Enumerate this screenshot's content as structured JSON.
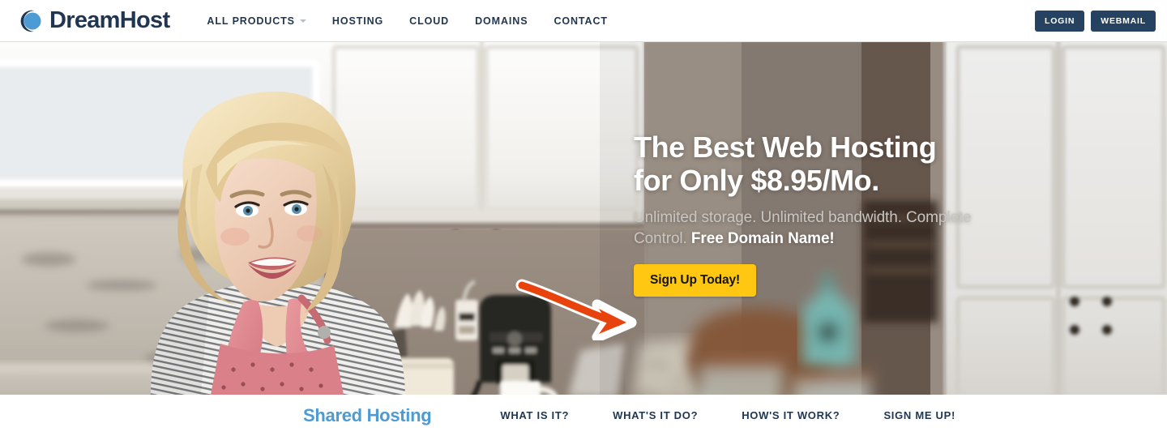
{
  "header": {
    "logo": {
      "text": "DreamHost",
      "icon": "dreamhost-crescent-logo",
      "mark_dark": "#1f3551",
      "mark_light": "#4C9BD4"
    },
    "nav": [
      {
        "label": "ALL PRODUCTS",
        "has_caret": true
      },
      {
        "label": "HOSTING",
        "has_caret": false
      },
      {
        "label": "CLOUD",
        "has_caret": false
      },
      {
        "label": "DOMAINS",
        "has_caret": false
      },
      {
        "label": "CONTACT",
        "has_caret": false
      }
    ],
    "actions": [
      {
        "label": "LOGIN"
      },
      {
        "label": "WEBMAIL"
      }
    ],
    "button_color": "#254360",
    "text_color": "#1f3551"
  },
  "hero": {
    "title": "The Best Web Hosting for Only $8.95/Mo.",
    "subtitle_muted": "Unlimited storage. Unlimited bandwidth. Complete Control.",
    "subtitle_strong": "Free Domain Name!",
    "cta_label": "Sign Up Today!",
    "cta_color": "#FFC711",
    "arrow_color": "#E8430C",
    "arrow_icon": "curved-arrow-right-icon",
    "image_alt": "blonde-woman-in-kitchen-photo"
  },
  "subnav": {
    "title": "Shared Hosting",
    "title_color": "#4C9BD4",
    "links": [
      {
        "label": "WHAT IS IT?"
      },
      {
        "label": "WHAT'S IT DO?"
      },
      {
        "label": "HOW'S IT WORK?"
      },
      {
        "label": "SIGN ME UP!"
      }
    ]
  }
}
